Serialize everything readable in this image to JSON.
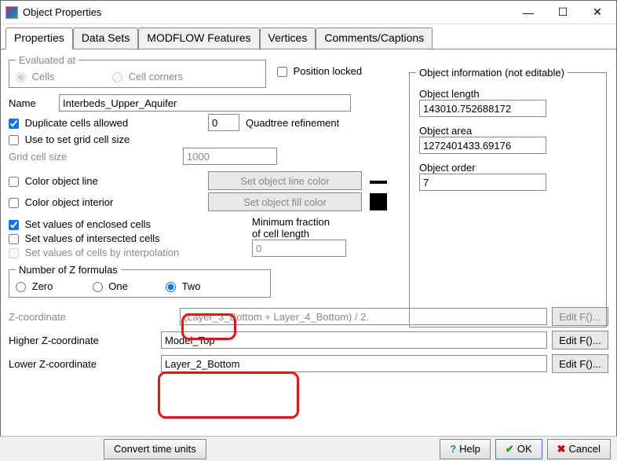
{
  "window": {
    "title": "Object Properties",
    "min": "—",
    "max": "☐",
    "close": "✕"
  },
  "tabs": {
    "t0": "Properties",
    "t1": "Data Sets",
    "t2": "MODFLOW Features",
    "t3": "Vertices",
    "t4": "Comments/Captions"
  },
  "eval": {
    "legend": "Evaluated at",
    "cells": "Cells",
    "corners": "Cell corners"
  },
  "poslock": "Position locked",
  "name_lbl": "Name",
  "name_val": "Interbeds_Upper_Aquifer",
  "dup": "Duplicate cells allowed",
  "quad_lbl": "Quadtree refinement",
  "quad_val": "0",
  "usegrid": "Use to set grid cell size",
  "gridcell_lbl": "Grid cell size",
  "gridcell_val": "1000",
  "colorline": "Color object line",
  "set_line": "Set object line color",
  "colorint": "Color object interior",
  "set_fill": "Set object fill color",
  "setv": {
    "enc": "Set values of enclosed cells",
    "int": "Set values of intersected cells",
    "interp": "Set values of cells by interpolation"
  },
  "minfrac_lbl1": "Minimum fraction",
  "minfrac_lbl2": "of cell length",
  "minfrac_val": "0",
  "zform": {
    "legend": "Number of Z formulas",
    "zero": "Zero",
    "one": "One",
    "two": "Two"
  },
  "zc_lbl": "Z-coordinate",
  "zc_val": "(Layer_3_Bottom + Layer_4_Bottom) / 2.",
  "hz_lbl": "Higher Z-coordinate",
  "hz_val": "Model_Top",
  "lz_lbl": "Lower Z-coordinate",
  "lz_val": "Layer_2_Bottom",
  "editf": "Edit F()...",
  "objinfo": {
    "legend": "Object information (not editable)",
    "len_lbl": "Object length",
    "len_val": "143010.752688172",
    "area_lbl": "Object area",
    "area_val": "1272401433.69176",
    "ord_lbl": "Object order",
    "ord_val": "7"
  },
  "bottom": {
    "convert": "Convert time units",
    "help": "Help",
    "ok": "OK",
    "cancel": "Cancel"
  }
}
